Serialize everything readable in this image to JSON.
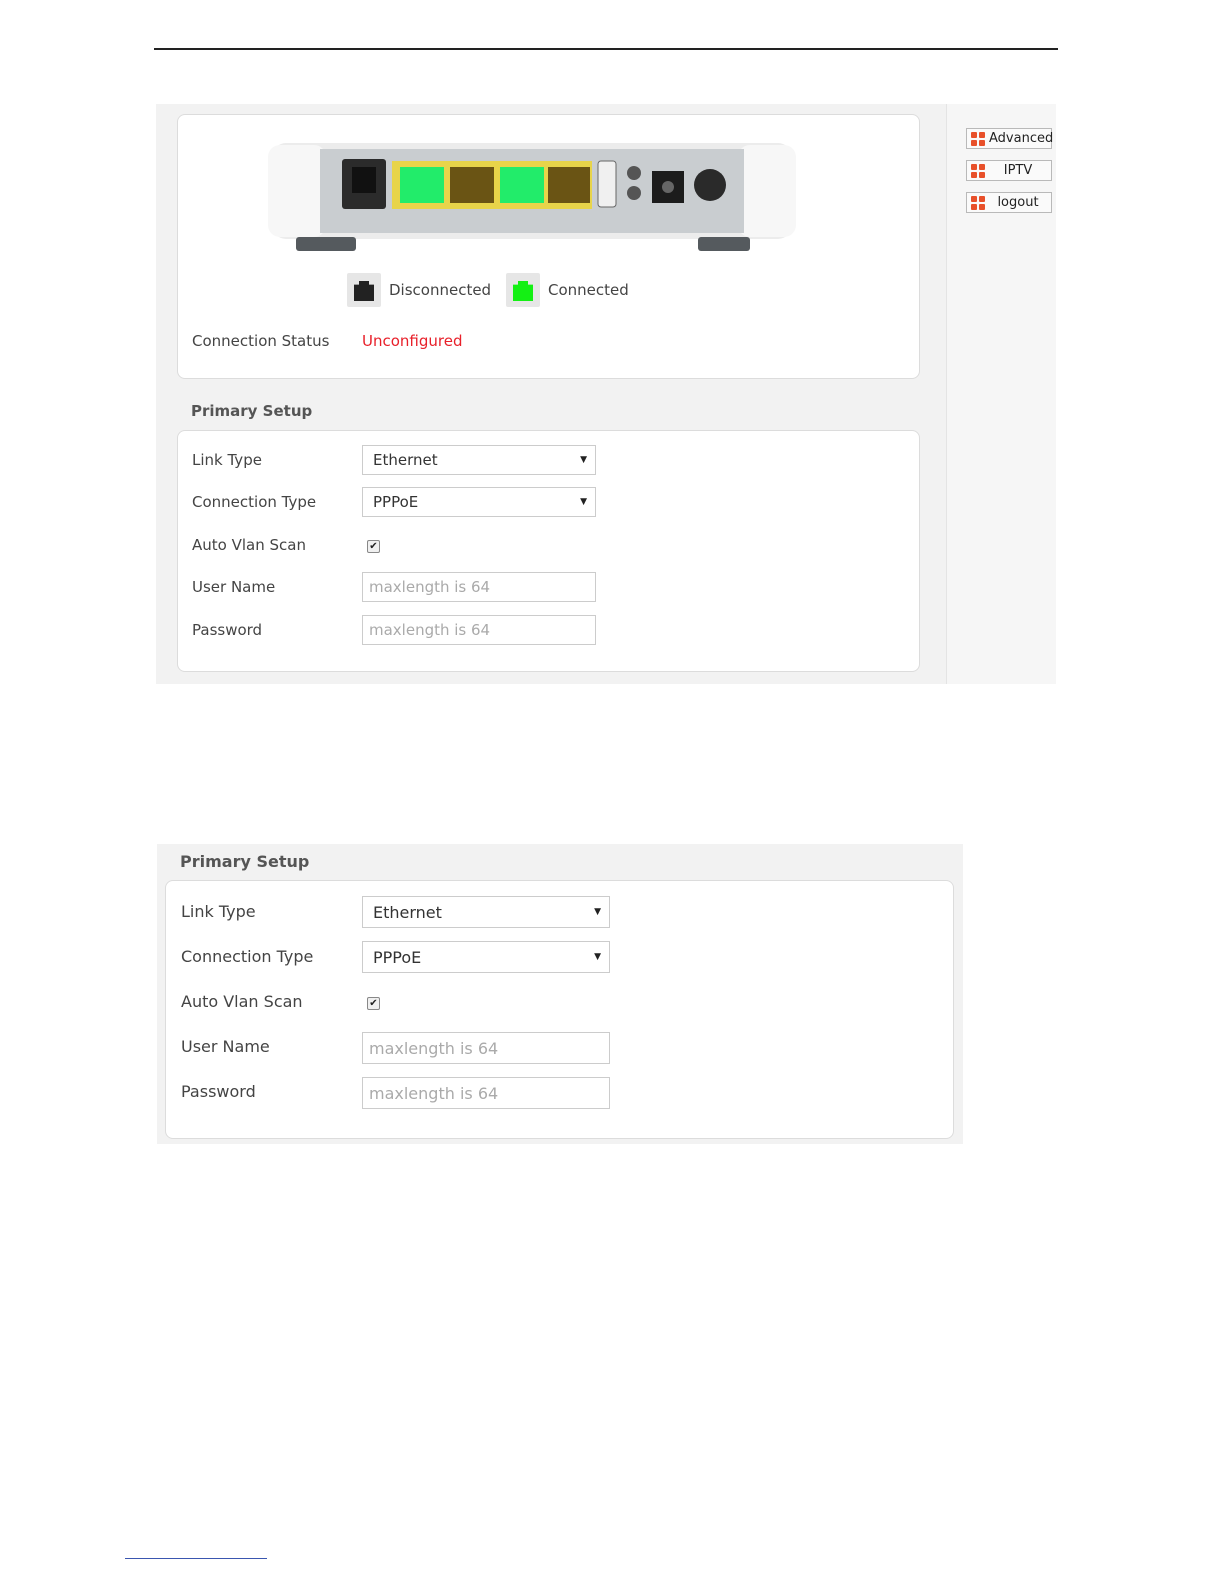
{
  "status_section": {
    "legend": {
      "disconnected_label": "Disconnected",
      "connected_label": "Connected",
      "disconnected_color": "#222222",
      "connected_color": "#14f014"
    },
    "connection_status_label": "Connection Status",
    "connection_status_value": "Unconfigured",
    "status_color": "#e8202a"
  },
  "sidebar": {
    "buttons": [
      {
        "label": "Advanced",
        "icon": "orange-grid-icon"
      },
      {
        "label": "IPTV",
        "icon": "orange-grid-icon"
      },
      {
        "label": "logout",
        "icon": "orange-grid-icon"
      }
    ]
  },
  "primary_setup": {
    "title": "Primary Setup",
    "link_type_label": "Link Type",
    "link_type_value": "Ethernet",
    "connection_type_label": "Connection Type",
    "connection_type_value": "PPPoE",
    "auto_vlan_scan_label": "Auto Vlan Scan",
    "auto_vlan_scan_checked": true,
    "user_name_label": "User Name",
    "user_name_placeholder": "maxlength is 64",
    "password_label": "Password",
    "password_placeholder": "maxlength is 64"
  }
}
